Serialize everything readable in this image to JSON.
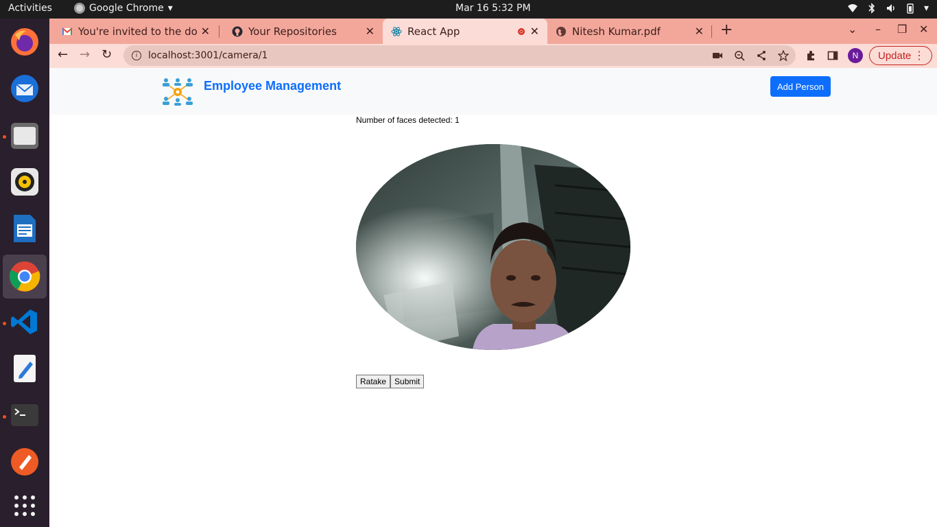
{
  "system_bar": {
    "activities": "Activities",
    "app_name": "Google Chrome",
    "clock": "Mar 16  5:32 PM"
  },
  "dock": {
    "items": [
      "firefox-icon",
      "thunderbird-icon",
      "files-icon",
      "rhythmbox-icon",
      "libreoffice-writer-icon",
      "chrome-icon",
      "vscode-icon",
      "text-editor-icon",
      "terminal-icon",
      "postman-icon",
      "app-grid-icon"
    ],
    "active": "chrome-icon",
    "accent_color": "#e95420"
  },
  "browser": {
    "tabs": [
      {
        "title": "You're invited to the docu",
        "icon": "gmail-icon",
        "active": false
      },
      {
        "title": "Your Repositories",
        "icon": "github-icon",
        "active": false
      },
      {
        "title": "React App",
        "icon": "react-icon",
        "active": true,
        "recording": true
      },
      {
        "title": "Nitesh Kumar.pdf",
        "icon": "globe-icon",
        "active": false
      }
    ],
    "url": "localhost:3001/camera/1",
    "profile_initial": "N",
    "update_label": "Update",
    "theme_color": "#f3a79b"
  },
  "app": {
    "brand": "Employee Management",
    "add_person_label": "Add Person",
    "faces_detected_text": "Number of faces detected: 1",
    "ratake_label": "Ratake",
    "submit_label": "Submit",
    "primary_color": "#0d6efd"
  }
}
